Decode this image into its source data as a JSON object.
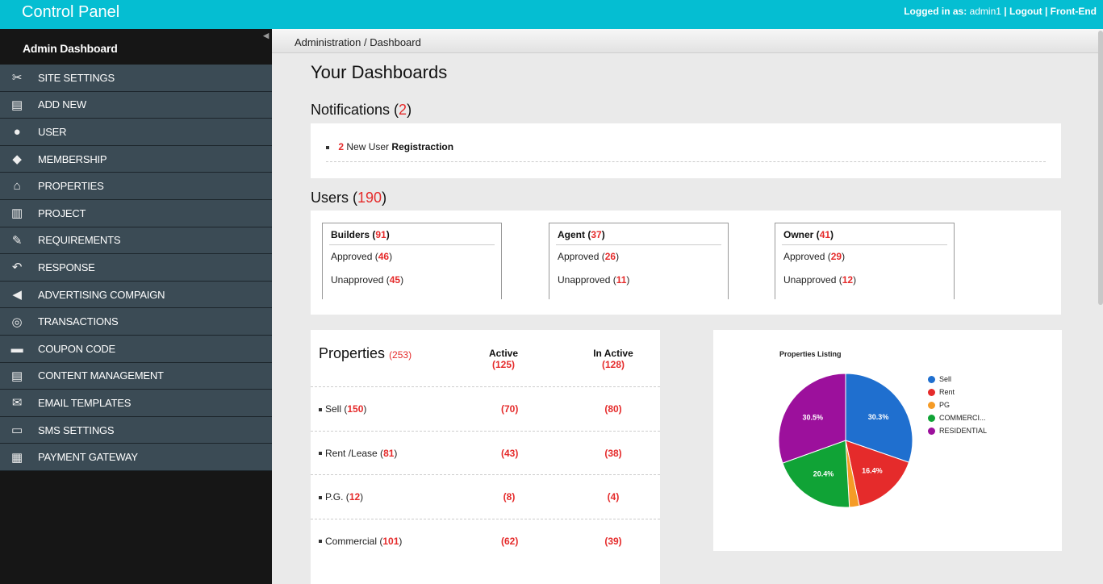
{
  "header": {
    "brand": "Control Panel",
    "logged_label": "Logged in as:",
    "user": "admin1",
    "sep": "|",
    "logout": "Logout",
    "frontend": "Front-End"
  },
  "sidebar": {
    "title": "Admin Dashboard",
    "items": [
      {
        "label": "SITE SETTINGS",
        "icon": "tools-icon"
      },
      {
        "label": "ADD NEW",
        "icon": "add-document-icon"
      },
      {
        "label": "USER",
        "icon": "user-icon"
      },
      {
        "label": "MEMBERSHIP",
        "icon": "membership-card-icon"
      },
      {
        "label": "PROPERTIES",
        "icon": "house-icon"
      },
      {
        "label": "PROJECT",
        "icon": "building-icon"
      },
      {
        "label": "REQUIREMENTS",
        "icon": "clipboard-icon"
      },
      {
        "label": "RESPONSE",
        "icon": "reply-icon"
      },
      {
        "label": "ADVERTISING COMPAIGN",
        "icon": "megaphone-icon"
      },
      {
        "label": "TRANSACTIONS",
        "icon": "transaction-icon"
      },
      {
        "label": "COUPON CODE",
        "icon": "coupon-icon"
      },
      {
        "label": "CONTENT MANAGEMENT",
        "icon": "content-icon"
      },
      {
        "label": "EMAIL TEMPLATES",
        "icon": "email-icon"
      },
      {
        "label": "SMS SETTINGS",
        "icon": "sms-icon"
      },
      {
        "label": "PAYMENT GATEWAY",
        "icon": "payment-icon"
      }
    ]
  },
  "breadcrumb": {
    "root": "Administration",
    "sep": "/",
    "current": "Dashboard"
  },
  "page_title": "Your Dashboards",
  "notifications": {
    "label": "Notifications",
    "count": "2",
    "item": {
      "count": "2",
      "text": "New User",
      "bold": "Registraction"
    }
  },
  "users": {
    "label": "Users",
    "count": "190",
    "boxes": [
      {
        "title": "Builders",
        "count": "91",
        "approved_label": "Approved",
        "approved": "46",
        "unapproved_label": "Unapproved",
        "unapproved": "45"
      },
      {
        "title": "Agent",
        "count": "37",
        "approved_label": "Approved",
        "approved": "26",
        "unapproved_label": "Unapproved",
        "unapproved": "11"
      },
      {
        "title": "Owner",
        "count": "41",
        "approved_label": "Approved",
        "approved": "29",
        "unapproved_label": "Unapproved",
        "unapproved": "12"
      }
    ]
  },
  "properties": {
    "label": "Properties",
    "count": "(253)",
    "active_label": "Active",
    "active_total": "(125)",
    "inactive_label": "In Active",
    "inactive_total": "(128)",
    "rows": [
      {
        "name": "Sell",
        "count": "150",
        "active": "(70)",
        "inactive": "(80)"
      },
      {
        "name": "Rent /Lease",
        "count": "81",
        "active": "(43)",
        "inactive": "(38)"
      },
      {
        "name": "P.G.",
        "count": "12",
        "active": "(8)",
        "inactive": "(4)"
      },
      {
        "name": "Commercial",
        "count": "101",
        "active": "(62)",
        "inactive": "(39)"
      }
    ]
  },
  "chart_data": {
    "type": "pie",
    "title": "Properties Listing",
    "categories": [
      "Sell",
      "Rent",
      "PG",
      "COMMERCI...",
      "RESIDENTIAL"
    ],
    "values": [
      30.3,
      16.4,
      2.4,
      20.4,
      30.5
    ],
    "labels": [
      "30.3%",
      "16.4%",
      "",
      "20.4%",
      "30.5%"
    ],
    "colors": [
      "#1f6fcf",
      "#e52b2b",
      "#f59b26",
      "#10a336",
      "#9c109c"
    ],
    "legend": "right"
  }
}
